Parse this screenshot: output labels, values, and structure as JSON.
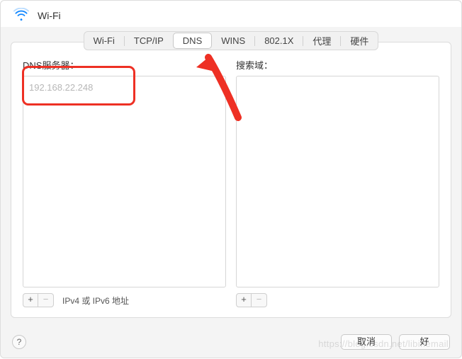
{
  "header": {
    "title": "Wi-Fi"
  },
  "tabs": {
    "items": [
      {
        "label": "Wi-Fi"
      },
      {
        "label": "TCP/IP"
      },
      {
        "label": "DNS"
      },
      {
        "label": "WINS"
      },
      {
        "label": "802.1X"
      },
      {
        "label": "代理"
      },
      {
        "label": "硬件"
      }
    ],
    "selected_index": 2
  },
  "left_column": {
    "label": "DNS服务器：",
    "items": [
      {
        "value": "192.168.22.248"
      }
    ],
    "footer_note": "IPv4 或 IPv6 地址",
    "plus": "+",
    "minus": "−"
  },
  "right_column": {
    "label": "搜索域：",
    "items": [],
    "plus": "+",
    "minus": "−"
  },
  "footer": {
    "help": "?",
    "cancel": "取消",
    "ok": "好"
  },
  "watermark": "https://blog.csdn.net/libinemail"
}
